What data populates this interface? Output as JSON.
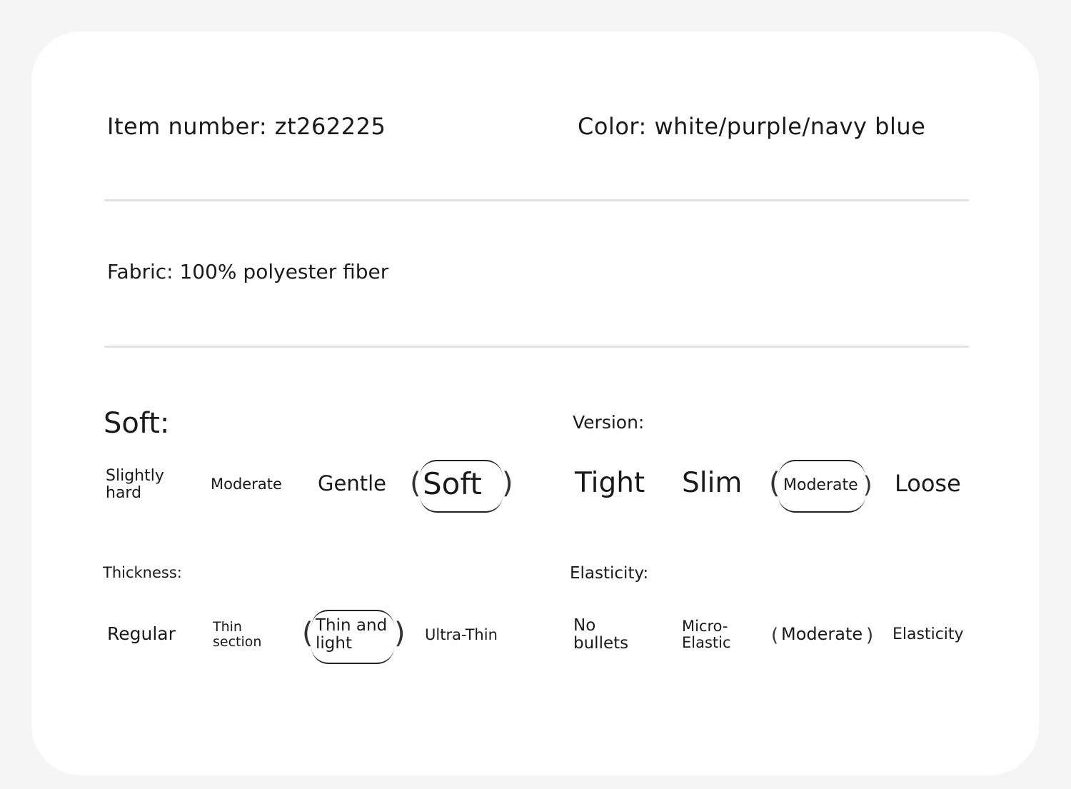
{
  "header": {
    "item_number": "Item number: zt262225",
    "color": "Color: white/purple/navy blue"
  },
  "fabric": "Fabric: 100% polyester fiber",
  "soft": {
    "title": "Soft:",
    "options": [
      "Slightly hard",
      "Moderate",
      "Gentle",
      "Soft"
    ],
    "selected": "Soft"
  },
  "version": {
    "title": "Version:",
    "options": [
      "Tight",
      "Slim",
      "Moderate",
      "Loose"
    ],
    "selected": "Moderate"
  },
  "thickness": {
    "title": "Thickness:",
    "options": [
      "Regular",
      "Thin section",
      "Thin and light",
      "Ultra-Thin"
    ],
    "selected": "Thin and light"
  },
  "elasticity": {
    "title": "Elasticity:",
    "options": [
      "No bullets",
      "Micro-Elastic",
      "Moderate",
      "Elasticity"
    ],
    "selected": "Moderate"
  },
  "colors": {
    "background": "#f5f5f5",
    "card": "#ffffff",
    "rule": "#e2e2e2",
    "text": "#1a1a1a"
  }
}
